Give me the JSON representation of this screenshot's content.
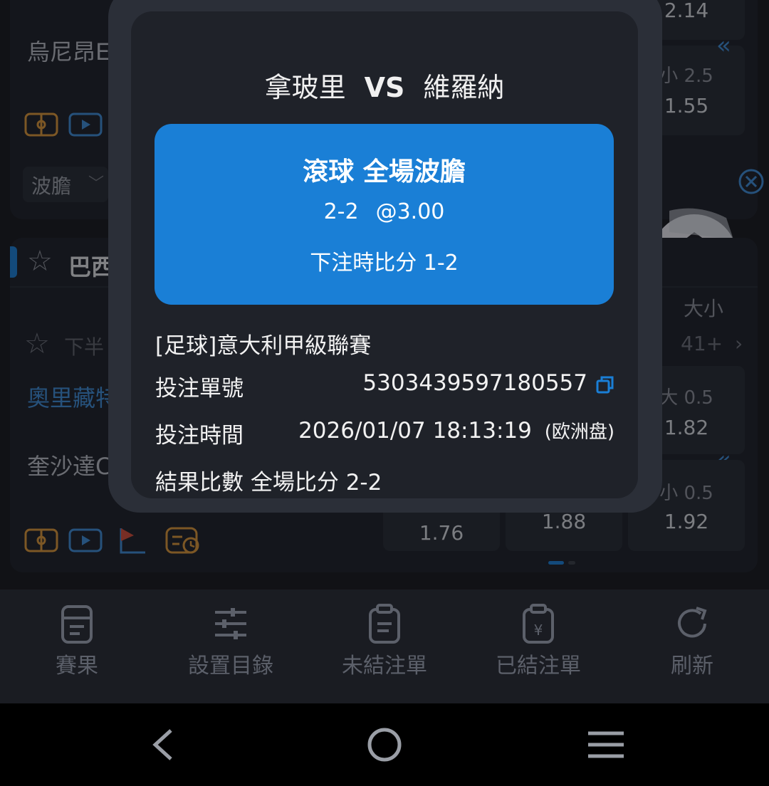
{
  "background": {
    "team_top": "烏尼昂E",
    "market_select": "波膽",
    "league_header": "巴西",
    "half_label": "下半",
    "team_home": "奧里藏特",
    "team_away": "奎沙達C",
    "more_markets": "41+",
    "odds_top_value": "2.14",
    "odds_under_label": "小 2.5",
    "odds_under_value": "1.55",
    "odds_over2_label": "大 0.5",
    "odds_over2_value": "1.82",
    "odds_under2_label": "小 0.5",
    "odds_under2_value": "1.92",
    "odds_row_b1": "1.76",
    "odds_row_b2": "1.88",
    "partial_label": "大小"
  },
  "modal": {
    "home_team": "拿玻里",
    "vs": "VS",
    "away_team": "維羅納",
    "bet_market": "滾球 全場波膽",
    "bet_selection": "2-2",
    "bet_odds": "@3.00",
    "score_at_bet": "下注時比分 1-2",
    "league": "[足球]意大利甲級聯賽",
    "ticket_label": "投注單號",
    "ticket_value": "5303439597180557",
    "time_label": "投注時間",
    "time_value": "2026/01/07 18:13:19",
    "odds_type": "(欧洲盘)",
    "result_label": "結果比數 全場比分 2-2"
  },
  "tabbar": [
    {
      "label": "賽果",
      "icon": "results-icon"
    },
    {
      "label": "設置目錄",
      "icon": "settings-sliders-icon"
    },
    {
      "label": "未結注單",
      "icon": "clipboard-icon"
    },
    {
      "label": "已結注單",
      "icon": "clipboard-yen-icon"
    },
    {
      "label": "刷新",
      "icon": "refresh-icon"
    }
  ],
  "colors": {
    "accent_blue": "#1a7fd6",
    "background": "#16181e",
    "modal": "#1f2229",
    "icon_orange": "#d9953a"
  }
}
